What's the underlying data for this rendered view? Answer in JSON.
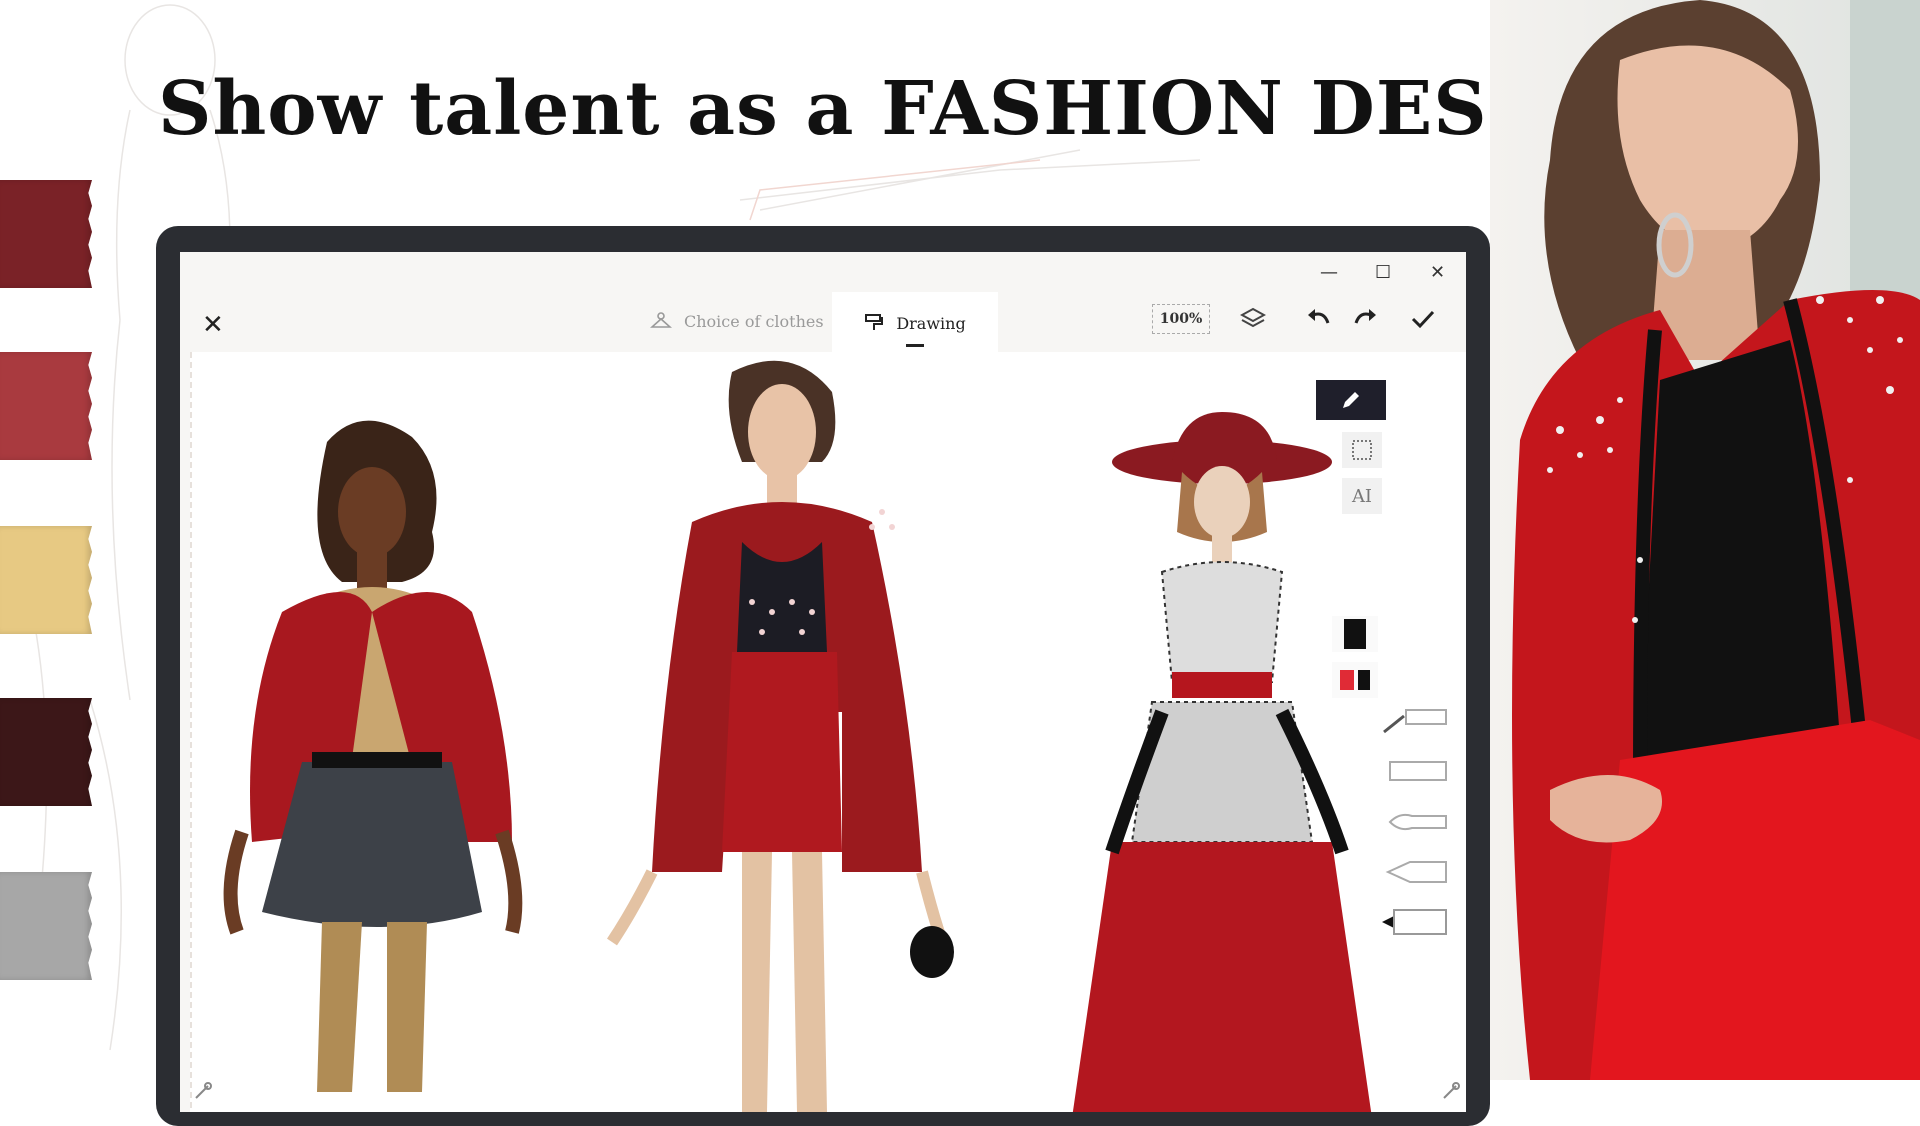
{
  "headline": "Show talent as a FASHION DESIGNER",
  "swatches": [
    "#7a2227",
    "#a93a3f",
    "#e7c983",
    "#3c1718",
    "#a7a7a7"
  ],
  "app": {
    "window_controls": {
      "minimize": "—",
      "maximize": "☐",
      "close": "✕"
    },
    "close_label": "✕",
    "tabs": [
      {
        "label": "Choice of clothes",
        "active": false,
        "icon": "hanger-icon"
      },
      {
        "label": "Drawing",
        "active": true,
        "icon": "paint-roller-icon"
      }
    ],
    "zoom": "100%",
    "tools": [
      "layers-icon",
      "undo-icon",
      "redo-icon",
      "confirm-icon"
    ],
    "side_tools": [
      {
        "name": "pencil-tool",
        "active": true
      },
      {
        "name": "pattern-tool",
        "active": false
      },
      {
        "name": "ai-tool",
        "label": "AI",
        "active": false
      }
    ],
    "color_slots": [
      [
        "#111111"
      ],
      [
        "#e02b36",
        "#111111"
      ]
    ],
    "brushes": [
      "zipper-brush",
      "flat-brush",
      "round-brush",
      "pencil-brush",
      "marker-brush"
    ]
  },
  "colors": {
    "accent": "#1f1f2b",
    "red": "#b8191f",
    "tablet": "#2b2d32"
  }
}
